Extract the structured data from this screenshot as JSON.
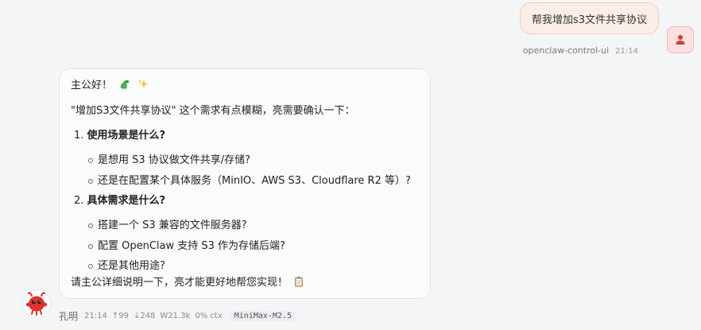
{
  "user_message": {
    "text": "帮我增加s3文件共享协议",
    "sender": "openclaw-control-ui",
    "time": "21:14",
    "avatar_icon": "user-icon"
  },
  "assistant_message": {
    "greeting": "主公好！",
    "greeting_icons": [
      "dragon-icon",
      "sparkles-icon"
    ],
    "intro": "\"增加S3文件共享协议\" 这个需求有点模糊，亮需要确认一下：",
    "questions": [
      {
        "number": "1.",
        "title": "使用场景是什么?",
        "items": [
          "是想用 S3 协议做文件共享/存储?",
          "还是在配置某个具体服务（MinIO、AWS S3、Cloudflare R2 等）?"
        ]
      },
      {
        "number": "2.",
        "title": "具体需求是什么?",
        "items": [
          "搭建一个 S3 兼容的文件服务器?",
          "配置 OpenClaw 支持 S3 作为存储后端?",
          "还是其他用途?"
        ]
      }
    ],
    "closing": "请主公详细说明一下，亮才能更好地帮您实现！",
    "closing_icon": "clipboard-icon",
    "avatar_icon": "red-mascot-icon"
  },
  "assistant_meta": {
    "name": "孔明",
    "time": "21:14",
    "tokens_in": "↑99",
    "tokens_out": "↓248",
    "window": "W21.3k",
    "ctx": "0% ctx",
    "model": "MiniMax-M2.5"
  }
}
